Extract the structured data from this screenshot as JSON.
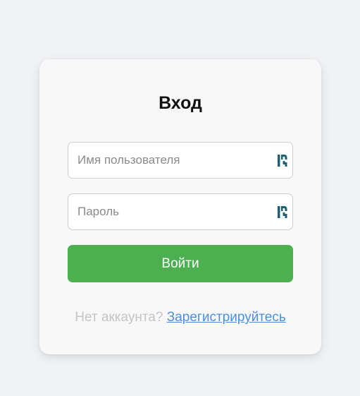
{
  "login": {
    "title": "Вход",
    "username_placeholder": "Имя пользователя",
    "username_value": "",
    "password_placeholder": "Пароль",
    "password_value": "",
    "submit_label": "Войти",
    "register_prompt": "Нет аккаунта?",
    "register_link": "Зарегистрируйтесь"
  },
  "icons": {
    "field_autofill_icon": "password-manager-icon"
  },
  "colors": {
    "background": "#f0f2f5",
    "card": "#f8f8f8",
    "button": "#4caf50",
    "link": "#4a90e2",
    "icon": "#1f5f73"
  }
}
